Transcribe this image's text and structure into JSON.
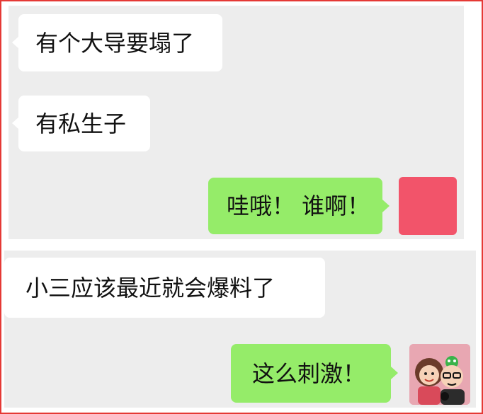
{
  "chat": {
    "section1": {
      "msg1": "有个大导要塌了",
      "msg2": "有私生子",
      "msg3": "哇哦！ 谁啊！"
    },
    "section2": {
      "msg1": "小三应该最近就会爆料了",
      "msg2": "这么刺激！"
    }
  },
  "colors": {
    "outgoing_bubble": "#95ec69",
    "incoming_bubble": "#ffffff",
    "chat_background": "#ededed",
    "frame_border": "#e53935",
    "avatar_pink": "#f2546a"
  }
}
